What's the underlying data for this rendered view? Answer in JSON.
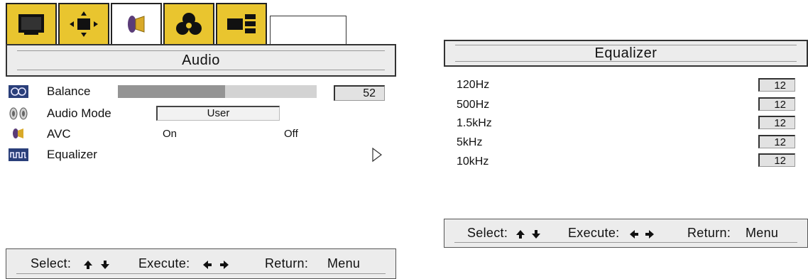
{
  "audio_panel": {
    "tabs": [
      {
        "name": "picture-tab",
        "icon": "monitor-icon",
        "active": false
      },
      {
        "name": "position-tab",
        "icon": "position-arrows-icon",
        "active": false
      },
      {
        "name": "audio-tab",
        "icon": "speaker-icon",
        "active": true
      },
      {
        "name": "color-tab",
        "icon": "rgb-circles-icon",
        "active": false
      },
      {
        "name": "setup-tab",
        "icon": "options-grid-icon",
        "active": false
      }
    ],
    "title": "Audio",
    "items": [
      {
        "label": "Balance",
        "icon": "balance-icon",
        "value": "52",
        "fill_fraction": 0.54
      },
      {
        "label": "Audio Mode",
        "icon": "audio-mode-icon",
        "value": "User"
      },
      {
        "label": "AVC",
        "icon": "speaker-icon",
        "options": [
          "On",
          "Off"
        ]
      },
      {
        "label": "Equalizer",
        "icon": "equalizer-icon",
        "submenu_icon": "triangle-right-icon"
      }
    ]
  },
  "equalizer_panel": {
    "title": "Equalizer",
    "bands": [
      {
        "label": "120Hz",
        "value": "12"
      },
      {
        "label": "500Hz",
        "value": "12"
      },
      {
        "label": "1.5kHz",
        "value": "12"
      },
      {
        "label": "5kHz",
        "value": "12"
      },
      {
        "label": "10kHz",
        "value": "12"
      }
    ]
  },
  "footer": {
    "select_label": "Select:",
    "execute_label": "Execute:",
    "return_label": "Return:",
    "return_key": "Menu",
    "select_icons": [
      "arrow-up-icon",
      "arrow-down-icon"
    ],
    "execute_icons": [
      "arrow-left-icon",
      "arrow-right-icon"
    ]
  },
  "colors": {
    "tab_gold": "#e9c52f",
    "bar_fill": "#949494",
    "bar_track": "#d3d3d3",
    "panel_gray": "#ececec"
  }
}
